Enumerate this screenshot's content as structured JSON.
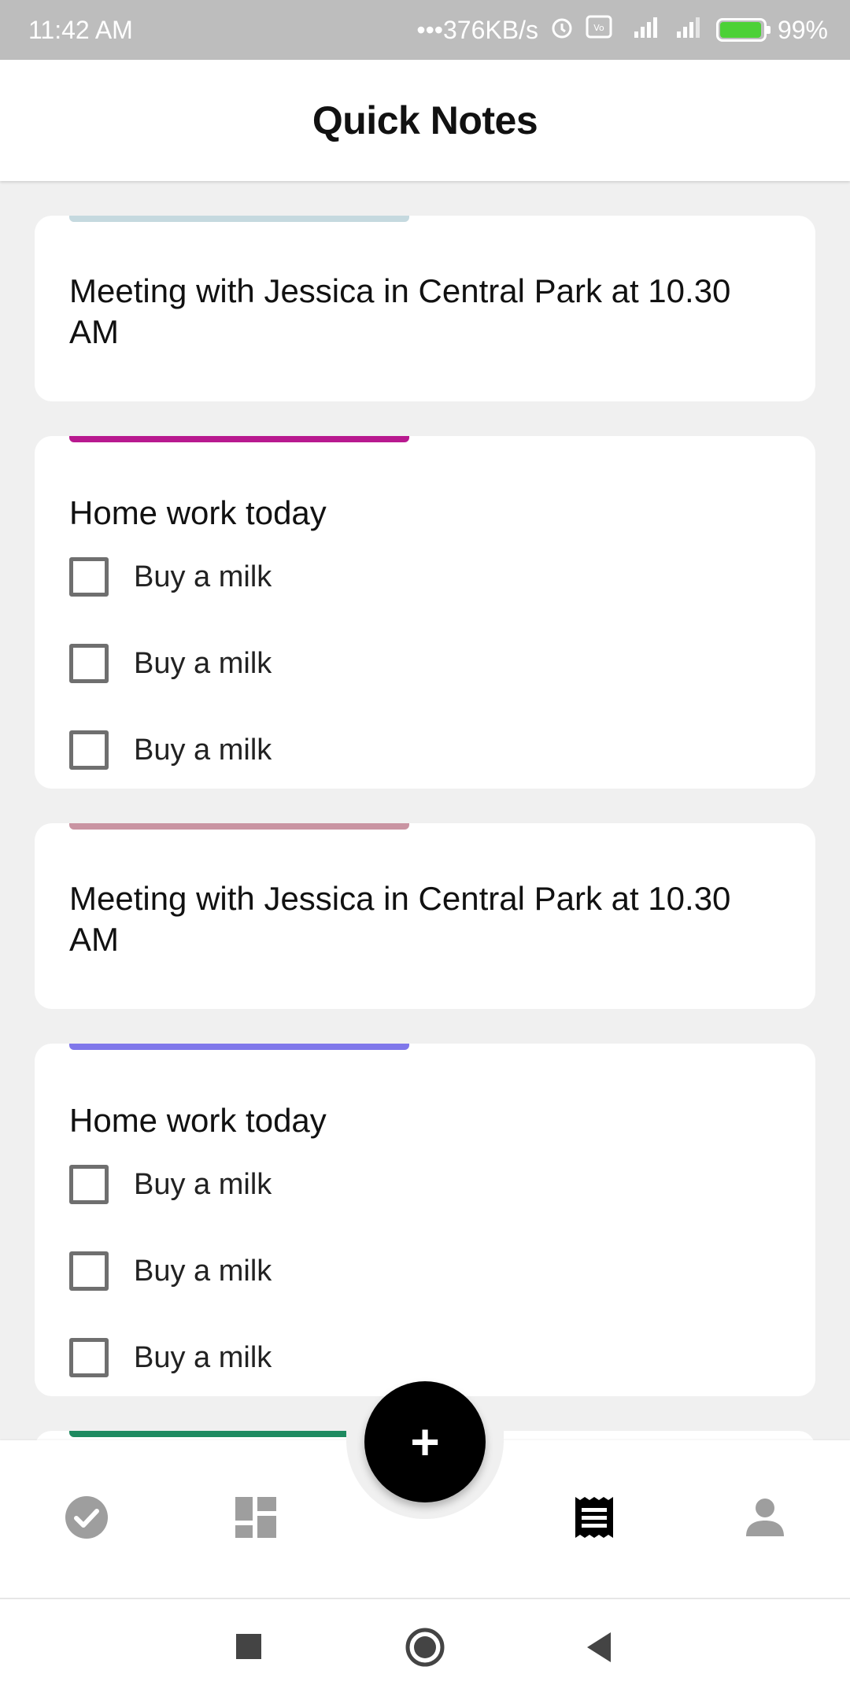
{
  "status_bar": {
    "time": "11:42 AM",
    "network_speed": "•••376KB/s",
    "battery": "99%",
    "icons": [
      "alarm-icon",
      "volte-icon",
      "signal-4g-icon",
      "signal-icon",
      "battery-charging-icon"
    ]
  },
  "app_bar": {
    "title": "Quick Notes"
  },
  "notes": [
    {
      "type": "text",
      "accent": "#c5d9df",
      "text": "Meeting with Jessica in Central Park at 10.30 AM"
    },
    {
      "type": "list",
      "accent": "#b8198f",
      "title": "Home work today",
      "items": [
        {
          "label": "Buy a milk",
          "checked": false
        },
        {
          "label": "Buy a milk",
          "checked": false
        },
        {
          "label": "Buy a milk",
          "checked": false
        }
      ]
    },
    {
      "type": "text",
      "accent": "#c994a2",
      "text": "Meeting with Jessica in Central Park at 10.30 AM"
    },
    {
      "type": "list",
      "accent": "#7f77ea",
      "title": "Home work today",
      "items": [
        {
          "label": "Buy a milk",
          "checked": false
        },
        {
          "label": "Buy a milk",
          "checked": false
        },
        {
          "label": "Buy a milk",
          "checked": false
        }
      ]
    },
    {
      "type": "partial",
      "accent": "#1e8a60"
    }
  ],
  "fab": {
    "label": "+",
    "icon": "add-icon"
  },
  "bottom_nav": {
    "items": [
      "check-circle-icon",
      "dashboard-icon",
      "notes-icon",
      "person-icon"
    ],
    "active": "notes-icon"
  },
  "system_nav": [
    "recents-icon",
    "home-icon",
    "back-icon"
  ]
}
